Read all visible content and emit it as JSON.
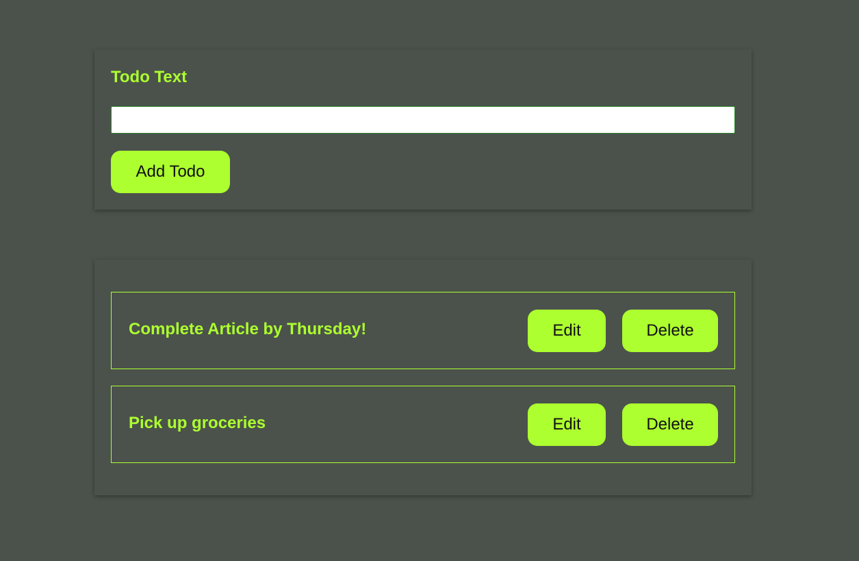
{
  "form": {
    "label": "Todo Text",
    "input_value": "",
    "input_placeholder": "",
    "add_button_label": "Add Todo"
  },
  "todos": [
    {
      "text": "Complete Article by Thursday!",
      "edit_label": "Edit",
      "delete_label": "Delete"
    },
    {
      "text": "Pick up groceries",
      "edit_label": "Edit",
      "delete_label": "Delete"
    }
  ],
  "colors": {
    "background": "#4b524b",
    "accent": "#adff2f",
    "button_text": "#111111",
    "input_background": "#ffffff"
  }
}
